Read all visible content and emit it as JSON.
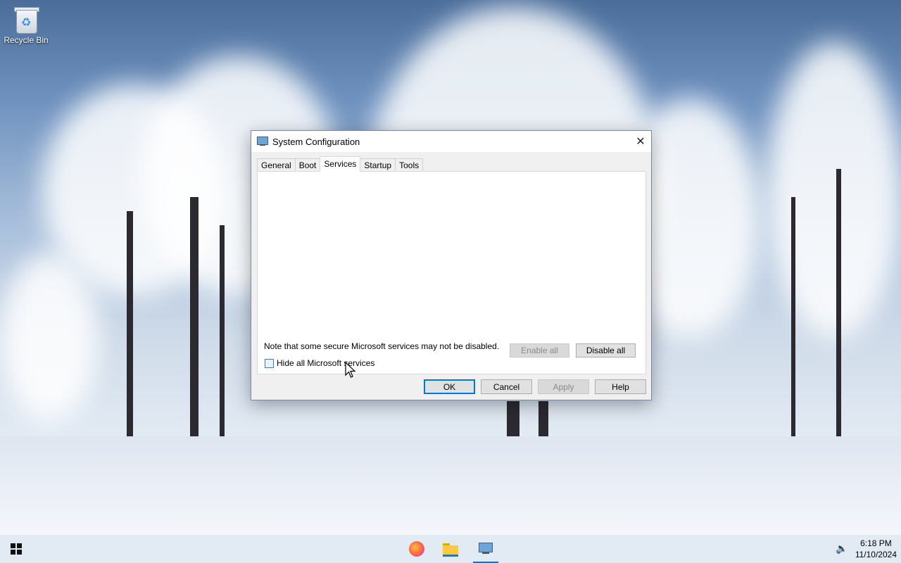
{
  "desktop": {
    "icons": [
      {
        "label": "Recycle Bin",
        "icon": "recycle-bin-icon"
      }
    ]
  },
  "dialog": {
    "title": "System Configuration",
    "close_label": "✕",
    "tabs": [
      {
        "label": "General",
        "active": false
      },
      {
        "label": "Boot",
        "active": false
      },
      {
        "label": "Services",
        "active": true
      },
      {
        "label": "Startup",
        "active": false
      },
      {
        "label": "Tools",
        "active": false
      }
    ],
    "services": {
      "note": "Note that some secure Microsoft services may not be disabled.",
      "hide_ms_label": "Hide all Microsoft services",
      "hide_ms_checked": false,
      "enable_all_label": "Enable all",
      "enable_all_disabled": true,
      "disable_all_label": "Disable all"
    },
    "buttons": {
      "ok": "OK",
      "cancel": "Cancel",
      "apply": "Apply",
      "apply_disabled": true,
      "help": "Help"
    }
  },
  "taskbar": {
    "apps": [
      {
        "name": "Firefox",
        "icon": "firefox-icon",
        "active": false
      },
      {
        "name": "File Explorer",
        "icon": "file-explorer-icon",
        "active": false
      },
      {
        "name": "System Configuration",
        "icon": "msconfig-icon",
        "active": true
      }
    ],
    "tray": {
      "volume_icon": "speaker-icon",
      "time": "6:18 PM",
      "date": "11/10/2024"
    }
  },
  "colors": {
    "accent": "#0078d7"
  }
}
